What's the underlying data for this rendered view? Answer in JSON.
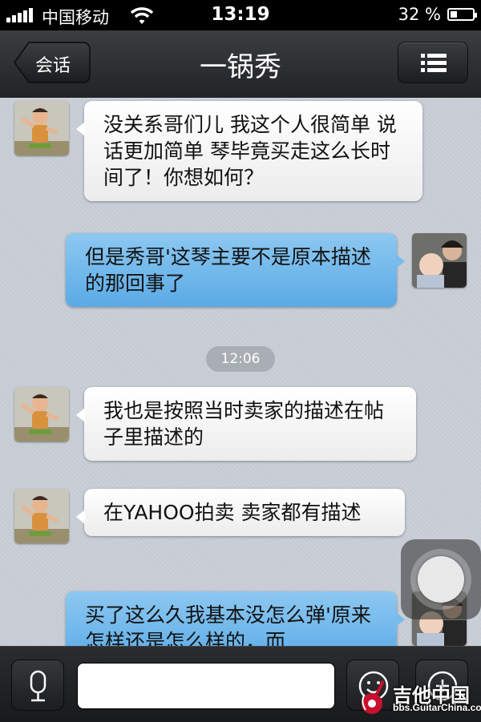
{
  "status_bar": {
    "carrier": "中国移动",
    "time": "13:19",
    "battery_percent": "32 %",
    "battery_level": 0.32
  },
  "nav": {
    "back_label": "会话",
    "title": "一锅秀",
    "menu_icon": "list-icon"
  },
  "messages": [
    {
      "direction": "in",
      "text": "没关系哥们儿 我这个人很简单 说话更加简单 琴毕竟买走这么长时间了！你想如何？"
    },
    {
      "direction": "out",
      "text": "但是秀哥'这琴主要不是原本描述的那回事了"
    },
    {
      "direction": "in",
      "text": "我也是按照当时卖家的描述在帖子里描述的"
    },
    {
      "direction": "in",
      "text": "在YAHOO拍卖 卖家都有描述"
    },
    {
      "direction": "out",
      "text": "买了这么久我基本没怎么弹'原来怎样还是怎么样的，而"
    }
  ],
  "timestamp": "12:06",
  "input_bar": {
    "value": "",
    "voice_icon": "microphone-icon",
    "emoji_icon": "smiley-icon",
    "more_icon": "plus-icon"
  },
  "watermark": {
    "name": "吉他中国",
    "url": "bbs.GuitarChina.com"
  },
  "colors": {
    "outgoing_bubble": "#6cb6ea",
    "incoming_bubble": "#ffffff",
    "nav_bar": "#2a2b2e",
    "chat_background": "#c9ced6"
  }
}
